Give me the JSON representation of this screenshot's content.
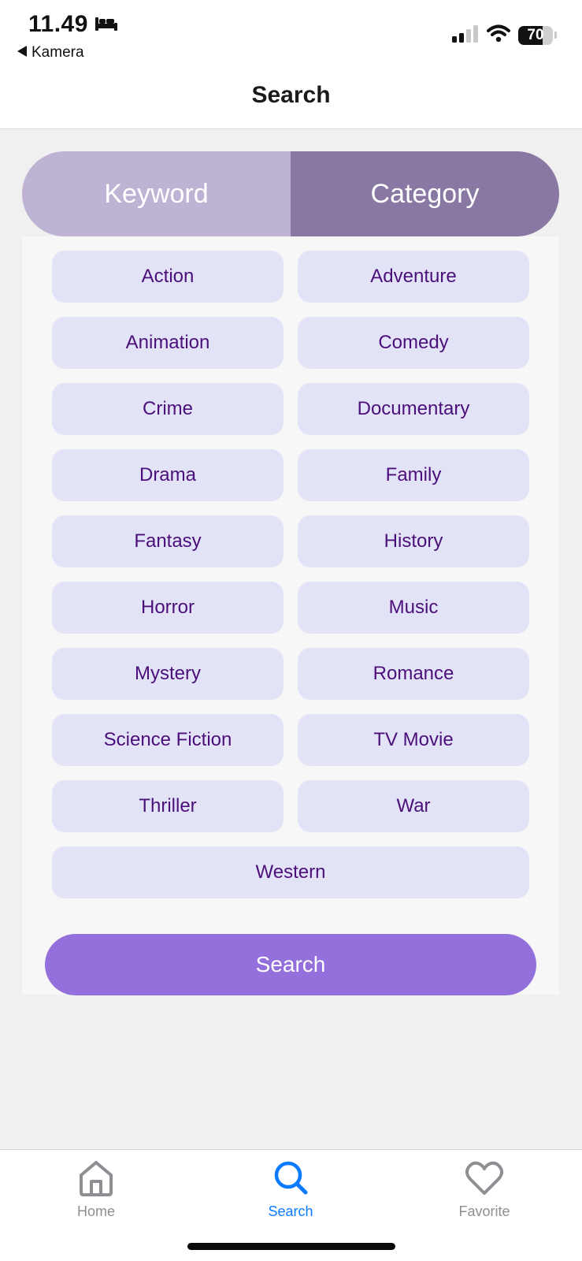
{
  "status_bar": {
    "time": "11.49",
    "back_app": "Kamera",
    "battery_level": "70",
    "battery_fraction": 0.7,
    "icons": [
      "bed-icon",
      "signal-icon",
      "wifi-icon",
      "battery-icon"
    ]
  },
  "header": {
    "title": "Search"
  },
  "segmented": {
    "keyword": "Keyword",
    "category": "Category",
    "selected": "Category"
  },
  "categories": [
    "Action",
    "Adventure",
    "Animation",
    "Comedy",
    "Crime",
    "Documentary",
    "Drama",
    "Family",
    "Fantasy",
    "History",
    "Horror",
    "Music",
    "Mystery",
    "Romance",
    "Science Fiction",
    "TV Movie",
    "Thriller",
    "War",
    "Western"
  ],
  "search_button": "Search",
  "tabbar": {
    "home": {
      "label": "Home",
      "icon": "home-icon",
      "color": "#8e8e93"
    },
    "search": {
      "label": "Search",
      "icon": "search-icon",
      "color": "#0a7aff",
      "active": true
    },
    "favorite": {
      "label": "Favorite",
      "icon": "heart-icon",
      "color": "#8e8e93"
    }
  },
  "colors": {
    "segment_inactive": "#bfb3d4",
    "segment_active": "#8a78a4",
    "chip_bg": "#e3e3f8",
    "chip_text": "#4b0f7a",
    "search_button": "#9370db"
  }
}
